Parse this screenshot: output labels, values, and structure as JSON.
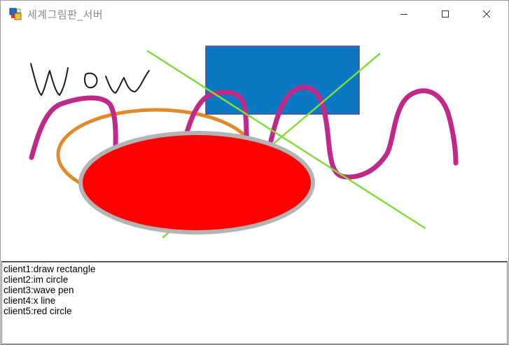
{
  "window": {
    "title": "세계그림판_서버",
    "icon": "app-icon",
    "controls": {
      "minimize_icon": "minimize-icon",
      "maximize_icon": "maximize-icon",
      "close_icon": "close-icon"
    }
  },
  "canvas": {
    "handwriting": "Wow",
    "shapes": [
      {
        "kind": "rectangle",
        "fill": "#0a78c2",
        "stroke": "#4a4a8a"
      },
      {
        "kind": "ellipse",
        "fill": "none",
        "stroke": "#e08a2a"
      },
      {
        "kind": "wave-pen",
        "stroke": "#c0288a"
      },
      {
        "kind": "x-line",
        "stroke": "#7ede3a"
      },
      {
        "kind": "ellipse",
        "fill": "#ff0000",
        "stroke": "#b4b4b4"
      }
    ]
  },
  "log": {
    "lines": [
      "client1:draw rectangle",
      "client2:im circle",
      "client3:wave pen",
      "client4:x line",
      "client5:red circle"
    ]
  }
}
